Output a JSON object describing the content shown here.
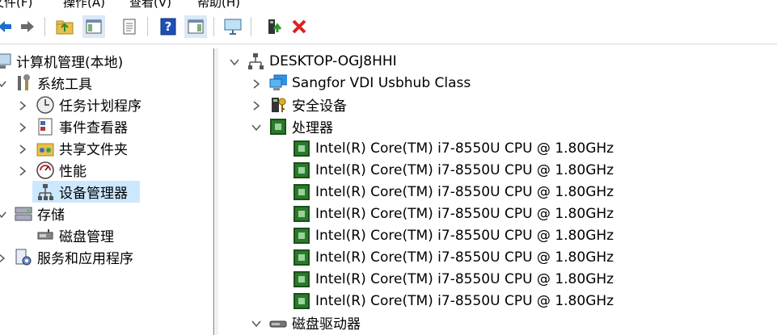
{
  "menu": {
    "file": "文件(F)",
    "action": "操作(A)",
    "view": "查看(V)",
    "help": "帮助(H)"
  },
  "left_tree": {
    "root": "计算机管理(本地)",
    "system_tools": "系统工具",
    "task_scheduler": "任务计划程序",
    "event_viewer": "事件查看器",
    "shared_folders": "共享文件夹",
    "performance": "性能",
    "device_manager": "设备管理器",
    "storage": "存储",
    "disk_management": "磁盘管理",
    "services_apps": "服务和应用程序"
  },
  "device_tree": {
    "computer": "DESKTOP-OGJ8HHI",
    "usbhub": "Sangfor VDI Usbhub Class",
    "security_devices": "安全设备",
    "processors": "处理器",
    "cpus": [
      "Intel(R) Core(TM) i7-8550U CPU @ 1.80GHz",
      "Intel(R) Core(TM) i7-8550U CPU @ 1.80GHz",
      "Intel(R) Core(TM) i7-8550U CPU @ 1.80GHz",
      "Intel(R) Core(TM) i7-8550U CPU @ 1.80GHz",
      "Intel(R) Core(TM) i7-8550U CPU @ 1.80GHz",
      "Intel(R) Core(TM) i7-8550U CPU @ 1.80GHz",
      "Intel(R) Core(TM) i7-8550U CPU @ 1.80GHz",
      "Intel(R) Core(TM) i7-8550U CPU @ 1.80GHz"
    ],
    "disk_drives": "磁盘驱动器"
  },
  "colors": {
    "selection": "#cce8ff",
    "accent": "#1a5fb4",
    "delete": "#e02020"
  }
}
